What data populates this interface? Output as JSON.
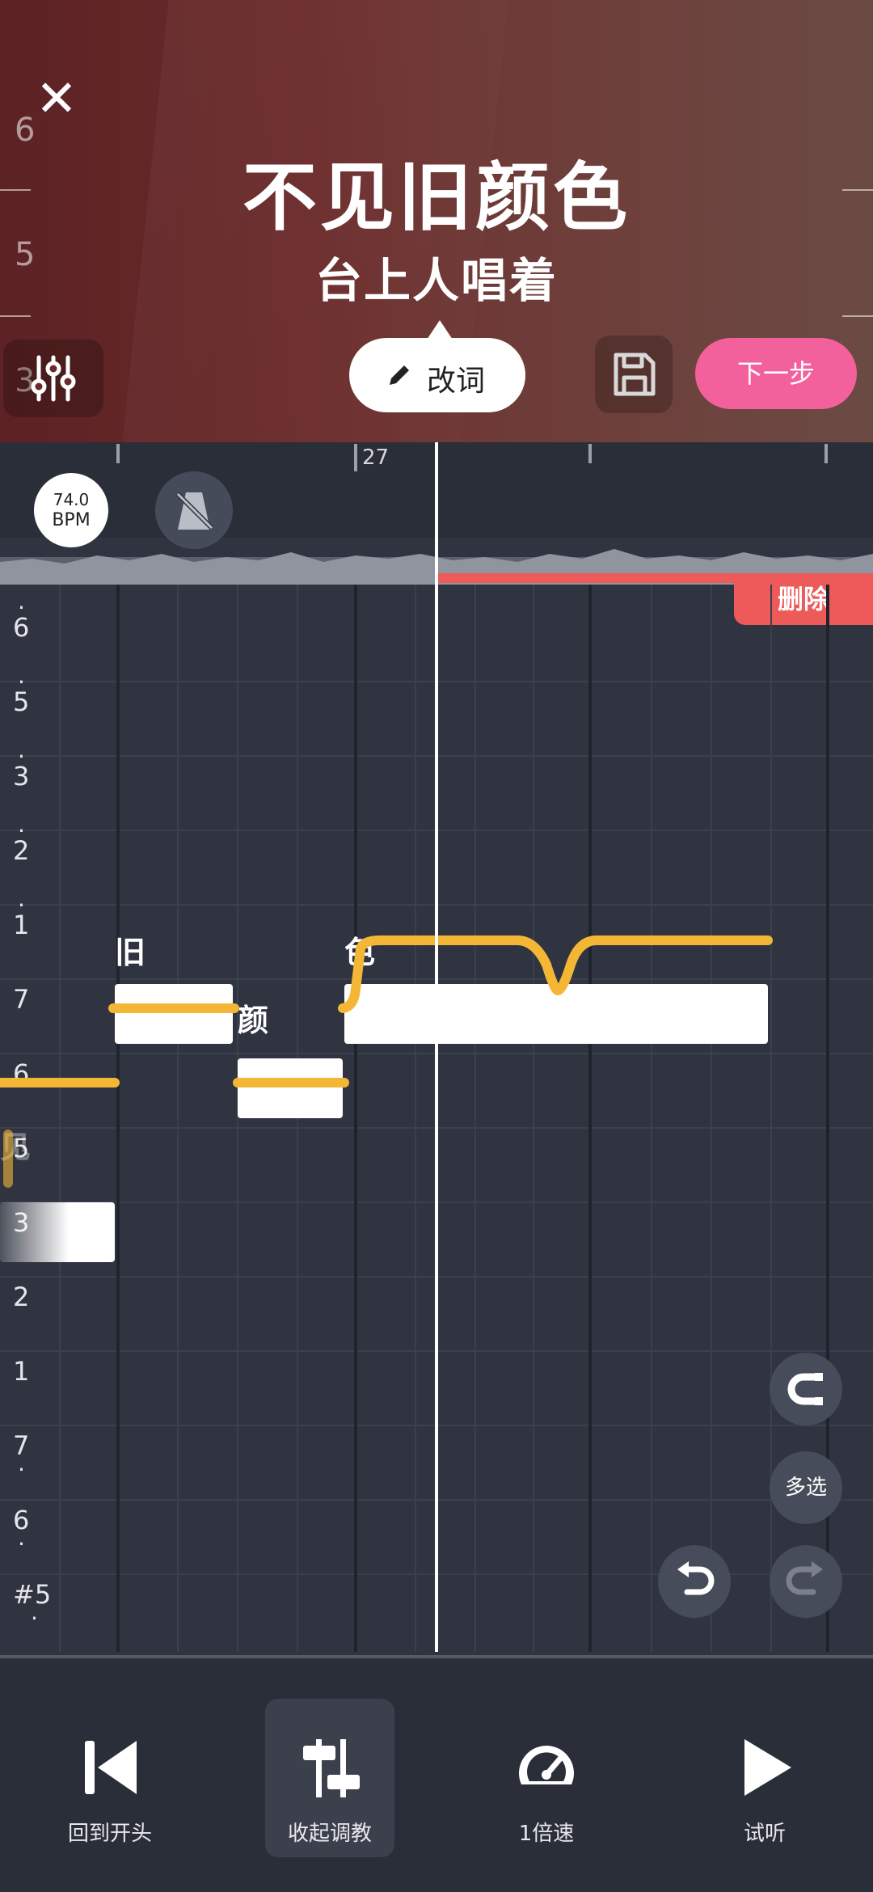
{
  "header": {
    "close_icon": "close-icon",
    "title": "不见旧颜色",
    "subtitle": "台上人唱着",
    "side_scale": [
      "6",
      "5",
      "3"
    ],
    "edit_lyrics_label": "改词",
    "next_label": "下一步"
  },
  "editor": {
    "bpm_value": "74.0",
    "bpm_unit": "BPM",
    "bar_number": "27",
    "delete_label": "删除",
    "pitch_labels": [
      "6",
      "5",
      "3",
      "2",
      "1",
      "7",
      "6",
      "5",
      "3",
      "2",
      "1",
      "7",
      "6",
      "#5"
    ],
    "notes": [
      {
        "lyric": "见",
        "pitch": "5"
      },
      {
        "lyric": "旧",
        "pitch": "7"
      },
      {
        "lyric": "颜",
        "pitch": "6"
      },
      {
        "lyric": "色",
        "pitch": "7"
      }
    ],
    "multi_select_label": "多选"
  },
  "bottom_bar": {
    "items": [
      {
        "label": "回到开头",
        "icon": "skip-back-icon"
      },
      {
        "label": "收起调教",
        "icon": "sliders-icon"
      },
      {
        "label": "1倍速",
        "icon": "speedometer-icon"
      },
      {
        "label": "试听",
        "icon": "play-icon"
      }
    ]
  },
  "colors": {
    "accent_pink": "#f2619b",
    "delete_red": "#ee5a59",
    "pitch_curve": "#f4b735",
    "editor_bg": "#2f3440"
  }
}
